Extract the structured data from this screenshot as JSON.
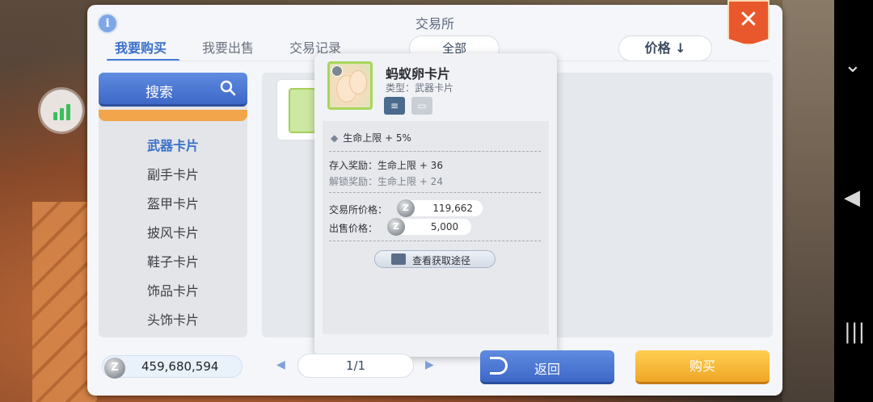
{
  "window": {
    "title": "交易所"
  },
  "tabs": [
    {
      "label": "我要购买",
      "active": true
    },
    {
      "label": "我要出售",
      "active": false
    },
    {
      "label": "交易记录",
      "active": false
    }
  ],
  "filter": {
    "selected": "全部"
  },
  "sort": {
    "label": "价格 ↓"
  },
  "search": {
    "label": "搜索"
  },
  "categories": [
    {
      "label": "武器卡片",
      "active": true
    },
    {
      "label": "副手卡片"
    },
    {
      "label": "盔甲卡片"
    },
    {
      "label": "披风卡片"
    },
    {
      "label": "鞋子卡片"
    },
    {
      "label": "饰品卡片"
    },
    {
      "label": "头饰卡片"
    }
  ],
  "tooltip": {
    "name": "蚂蚁卵卡片",
    "type": "类型：武器卡片",
    "stat": "生命上限 + 5%",
    "deposit_reward": "存入奖励：生命上限 + 36",
    "unlock_reward": "解锁奖励：生命上限 + 24",
    "exchange_price_label": "交易所价格：",
    "exchange_price": "119,662",
    "sell_price_label": "出售价格：",
    "sell_price": "5,000",
    "source_button": "查看获取途径"
  },
  "wallet": {
    "amount": "459,680,594"
  },
  "pagination": {
    "current": "1/1"
  },
  "buttons": {
    "back": "返回",
    "buy": "购买"
  },
  "colors": {
    "accent_blue": "#3e68c7",
    "buy_yellow": "#f0a626",
    "close_orange": "#e8582c",
    "card_green": "#a8d65b"
  }
}
